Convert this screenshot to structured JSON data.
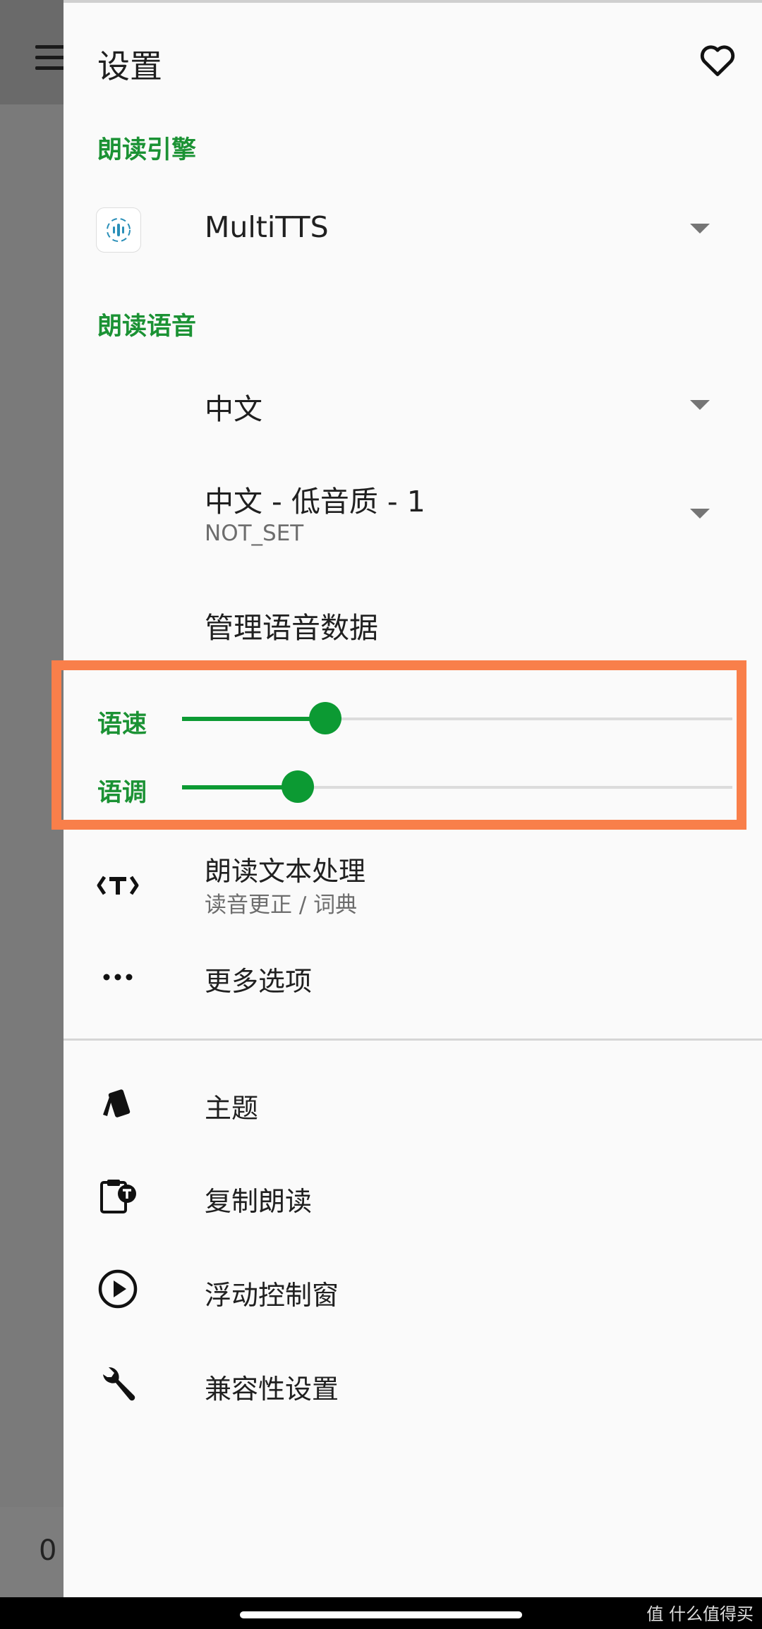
{
  "background": {
    "bottom_value": "0"
  },
  "header": {
    "title": "设置"
  },
  "engine": {
    "section_label": "朗读引擎",
    "selected": "MultiTTS"
  },
  "voice": {
    "section_label": "朗读语音",
    "language": "中文",
    "voice_name": "中文 - 低音质 - 1",
    "voice_sub": "NOT_SET",
    "manage_label": "管理语音数据"
  },
  "sliders": {
    "rate": {
      "label": "语速",
      "fraction": 0.26
    },
    "pitch": {
      "label": "语调",
      "fraction": 0.21
    }
  },
  "items": {
    "text_processing": {
      "label": "朗读文本处理",
      "sub": "读音更正 / 词典"
    },
    "more_options": {
      "label": "更多选项"
    },
    "theme": {
      "label": "主题"
    },
    "copy_read": {
      "label": "复制朗读"
    },
    "floating_window": {
      "label": "浮动控制窗"
    },
    "compat": {
      "label": "兼容性设置"
    }
  },
  "colors": {
    "accent": "#1b9234",
    "slider": "#0c9a33",
    "highlight": "#f97f4a"
  },
  "icons": [
    "menu-icon",
    "heart-icon",
    "tts-engine-icon",
    "dropdown-arrow-icon",
    "text-t-icon",
    "more-dots-icon",
    "theme-cards-icon",
    "clipboard-t-icon",
    "play-circle-icon",
    "wrench-icon"
  ],
  "watermark": "值 什么值得买"
}
